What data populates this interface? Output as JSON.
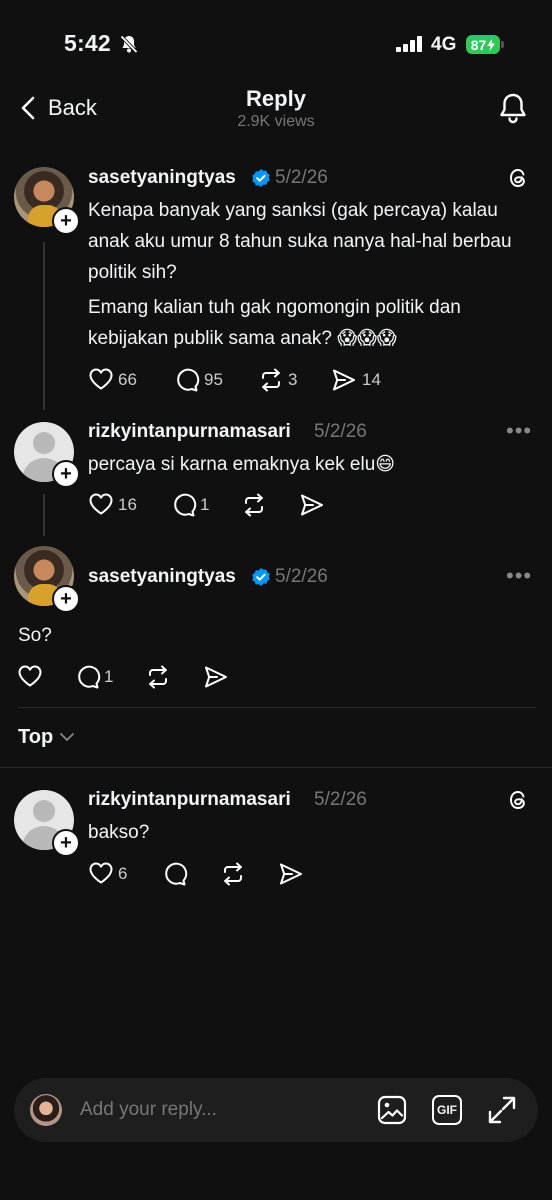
{
  "status_bar": {
    "time": "5:42",
    "network": "4G",
    "battery": "87"
  },
  "header": {
    "back_label": "Back",
    "title": "Reply",
    "views": "2.9K views"
  },
  "posts": [
    {
      "username": "sasetyaningtyas",
      "date": "5/2/26",
      "verified": true,
      "paragraphs": [
        "Kenapa banyak yang sanksi (gak percaya) kalau anak aku umur 8 tahun suka nanya hal-hal berbau politik sih?",
        "Emang kalian tuh gak ngomongin politik dan kebijakan publik sama anak? 😱😱😱"
      ],
      "likes": "66",
      "replies": "95",
      "reposts": "3",
      "shares": "14"
    },
    {
      "username": "rizkyintanpurnamasari",
      "date": "5/2/26",
      "text": "percaya si karna emaknya kek elu😄",
      "likes": "16",
      "replies": "1",
      "more": "•••"
    },
    {
      "username": "sasetyaningtyas",
      "date": "5/2/26",
      "verified": true,
      "text": "So?",
      "replies": "1",
      "more": "•••"
    }
  ],
  "sort": {
    "label": "Top"
  },
  "reply_posts": [
    {
      "username": "rizkyintanpurnamasari",
      "date": "5/2/26",
      "text": "bakso?",
      "likes": "6"
    }
  ],
  "reply_bar": {
    "placeholder": "Add your reply...",
    "gif_label": "GIF"
  },
  "icons": {
    "verified_color": "#0095f6",
    "battery_color": "#31c759"
  }
}
